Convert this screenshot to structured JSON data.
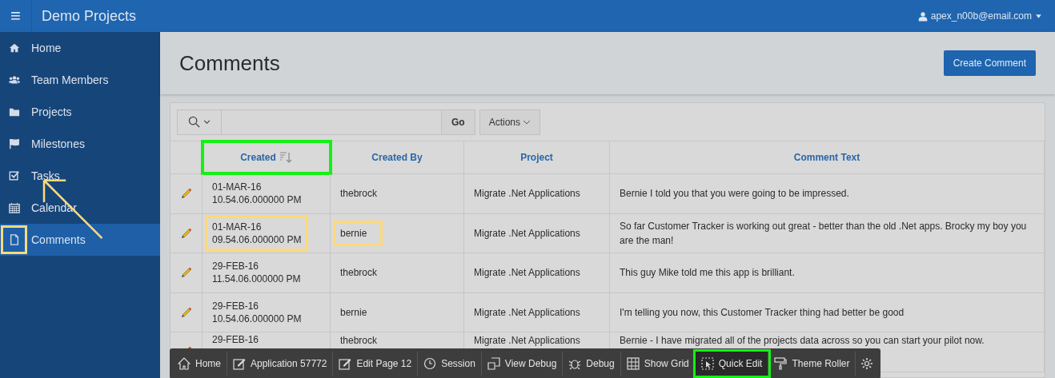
{
  "header": {
    "menu_icon": "≡",
    "title": "Demo Projects",
    "user": "apex_n00b@email.com"
  },
  "sidebar": {
    "items": [
      {
        "label": "Home",
        "selected": false
      },
      {
        "label": "Team Members",
        "selected": false
      },
      {
        "label": "Projects",
        "selected": false
      },
      {
        "label": "Milestones",
        "selected": false
      },
      {
        "label": "Tasks",
        "selected": false
      },
      {
        "label": "Calendar",
        "selected": false
      },
      {
        "label": "Comments",
        "selected": true
      }
    ]
  },
  "page": {
    "title": "Comments",
    "create_button": "Create Comment"
  },
  "report": {
    "go_button": "Go",
    "actions_button": "Actions",
    "columns": [
      {
        "label": "Created",
        "sorted": true
      },
      {
        "label": "Created By",
        "sorted": false
      },
      {
        "label": "Project",
        "sorted": false
      },
      {
        "label": "Comment Text",
        "sorted": false
      }
    ],
    "rows": [
      {
        "created": [
          "01-MAR-16",
          "10.54.06.000000 PM"
        ],
        "created_by": "thebrock",
        "project": "Migrate .Net Applications",
        "comment": "Bernie I told you that you were going to be impressed."
      },
      {
        "created": [
          "01-MAR-16",
          "09.54.06.000000 PM"
        ],
        "created_by": "bernie",
        "project": "Migrate .Net Applications",
        "comment": "So far Customer Tracker is working out great - better than the old .Net apps. Brocky my boy you are the man!"
      },
      {
        "created": [
          "29-FEB-16",
          "11.54.06.000000 PM"
        ],
        "created_by": "thebrock",
        "project": "Migrate .Net Applications",
        "comment": "This guy Mike told me this app is brilliant."
      },
      {
        "created": [
          "29-FEB-16",
          "10.54.06.000000 PM"
        ],
        "created_by": "bernie",
        "project": "Migrate .Net Applications",
        "comment": "I'm telling you now, this Customer Tracker thing had better be good"
      },
      {
        "created": [
          "29-FEB-16"
        ],
        "created_by": "thebrock",
        "project": "Migrate .Net Applications",
        "comment": "Bernie - I have migrated all of the projects data across so you can start your pilot now."
      }
    ]
  },
  "dev_toolbar": {
    "items": [
      {
        "label": "Home",
        "active": false
      },
      {
        "label": "Application 57772",
        "active": false
      },
      {
        "label": "Edit Page 12",
        "active": false
      },
      {
        "label": "Session",
        "active": false
      },
      {
        "label": "View Debug",
        "active": false
      },
      {
        "label": "Debug",
        "active": false
      },
      {
        "label": "Show Grid",
        "active": false
      },
      {
        "label": "Quick Edit",
        "active": true
      },
      {
        "label": "Theme Roller",
        "active": false
      }
    ]
  }
}
